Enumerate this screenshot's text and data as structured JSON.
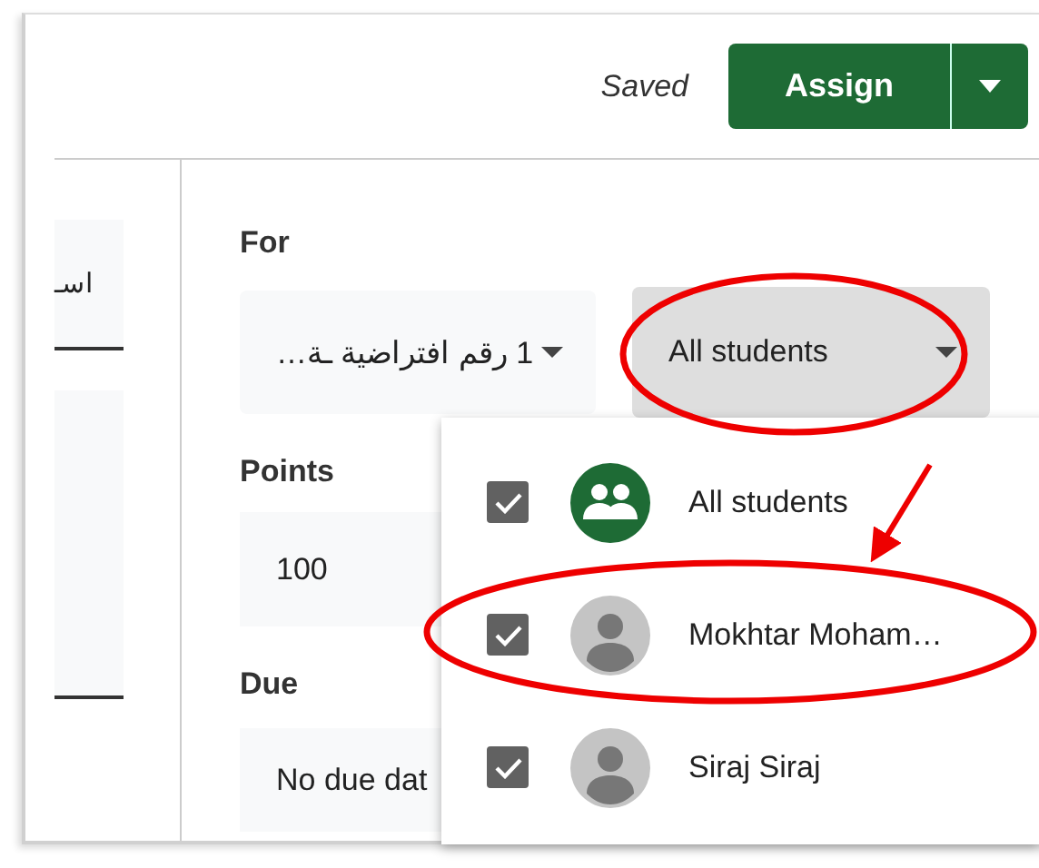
{
  "header": {
    "status": "Saved",
    "assign_button": "Assign"
  },
  "side_field": {
    "text": "اسـ"
  },
  "for": {
    "label": "For",
    "class_dropdown": "1 رقم افتراضية ـة…",
    "students_dropdown": "All students"
  },
  "points": {
    "label": "Points",
    "value": "100"
  },
  "due": {
    "label": "Due",
    "value": "No due dat"
  },
  "student_menu": [
    {
      "kind": "group",
      "name": "All students",
      "checked": true
    },
    {
      "kind": "person",
      "name": "Mokhtar Moham…",
      "checked": true
    },
    {
      "kind": "person",
      "name": "Siraj Siraj",
      "checked": true
    }
  ],
  "annotations": [
    {
      "kind": "ellipse"
    },
    {
      "kind": "arrow"
    },
    {
      "kind": "ellipse"
    }
  ]
}
